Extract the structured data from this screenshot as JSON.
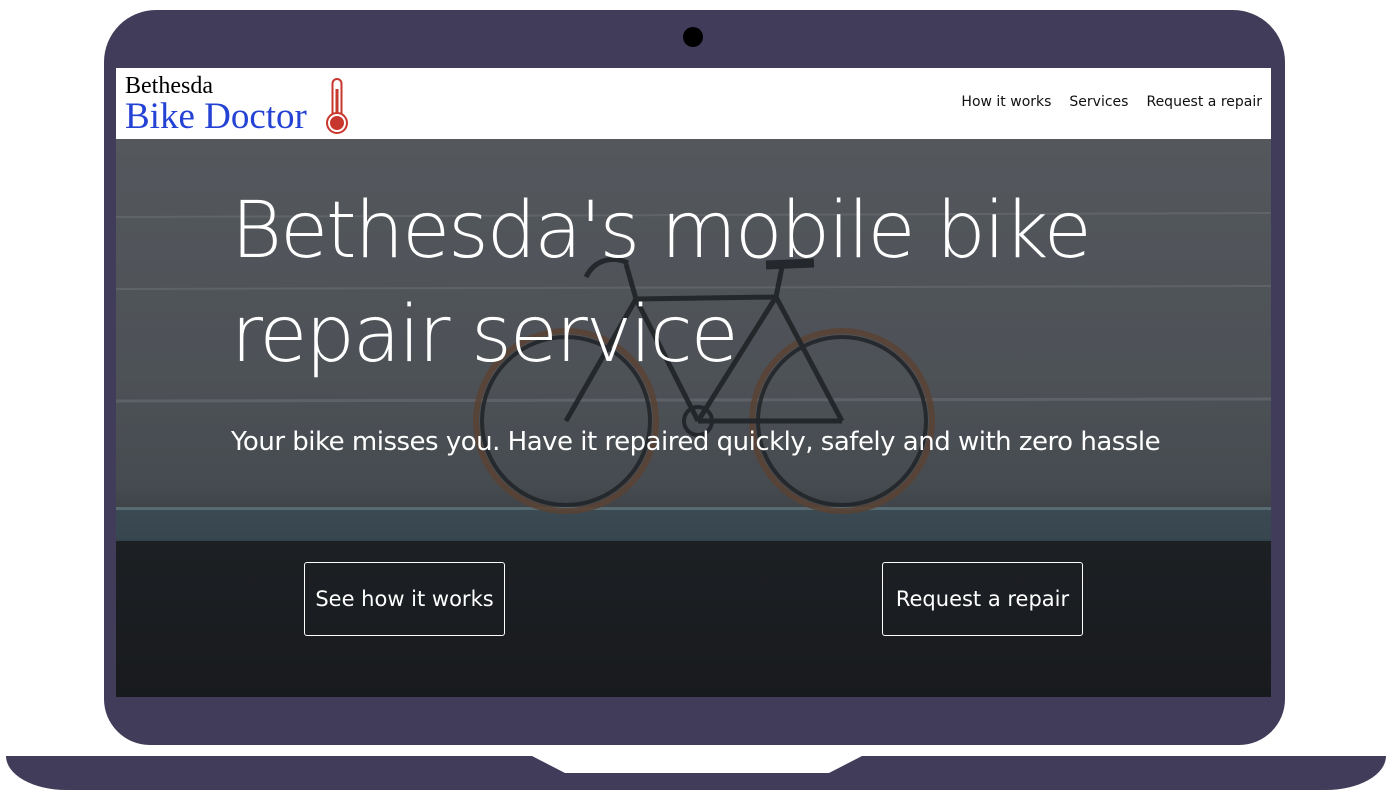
{
  "logo": {
    "line1": "Bethesda",
    "line2": "Bike Doctor",
    "icon": "thermometer-icon",
    "line2_color": "#2442d4",
    "icon_color": "#c8372d"
  },
  "nav": {
    "items": [
      {
        "label": "How it works"
      },
      {
        "label": "Services"
      },
      {
        "label": "Request a repair"
      }
    ]
  },
  "hero": {
    "title": "Bethesda's mobile bike repair service",
    "subtitle": "Your bike misses you. Have it repaired quickly, safely and with zero hassle",
    "buttons": {
      "left_label": "See how it works",
      "right_label": "Request a repair"
    },
    "background": "bicycle-against-concrete-wall-photo"
  },
  "frame": {
    "color": "#403c59"
  }
}
